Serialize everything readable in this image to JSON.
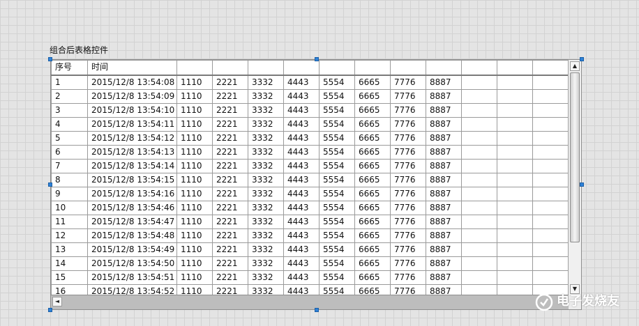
{
  "control_label": "组合后表格控件",
  "table": {
    "headers": [
      "序号",
      "时间",
      "",
      "",
      "",
      "",
      "",
      "",
      "",
      "",
      "",
      "",
      "",
      ""
    ],
    "rows": [
      [
        "1",
        "2015/12/8 13:54:08",
        "1110",
        "2221",
        "3332",
        "4443",
        "5554",
        "6665",
        "7776",
        "8887",
        "",
        "",
        "",
        ""
      ],
      [
        "2",
        "2015/12/8 13:54:09",
        "1110",
        "2221",
        "3332",
        "4443",
        "5554",
        "6665",
        "7776",
        "8887",
        "",
        "",
        "",
        ""
      ],
      [
        "3",
        "2015/12/8 13:54:10",
        "1110",
        "2221",
        "3332",
        "4443",
        "5554",
        "6665",
        "7776",
        "8887",
        "",
        "",
        "",
        ""
      ],
      [
        "4",
        "2015/12/8 13:54:11",
        "1110",
        "2221",
        "3332",
        "4443",
        "5554",
        "6665",
        "7776",
        "8887",
        "",
        "",
        "",
        ""
      ],
      [
        "5",
        "2015/12/8 13:54:12",
        "1110",
        "2221",
        "3332",
        "4443",
        "5554",
        "6665",
        "7776",
        "8887",
        "",
        "",
        "",
        ""
      ],
      [
        "6",
        "2015/12/8 13:54:13",
        "1110",
        "2221",
        "3332",
        "4443",
        "5554",
        "6665",
        "7776",
        "8887",
        "",
        "",
        "",
        ""
      ],
      [
        "7",
        "2015/12/8 13:54:14",
        "1110",
        "2221",
        "3332",
        "4443",
        "5554",
        "6665",
        "7776",
        "8887",
        "",
        "",
        "",
        ""
      ],
      [
        "8",
        "2015/12/8 13:54:15",
        "1110",
        "2221",
        "3332",
        "4443",
        "5554",
        "6665",
        "7776",
        "8887",
        "",
        "",
        "",
        ""
      ],
      [
        "9",
        "2015/12/8 13:54:16",
        "1110",
        "2221",
        "3332",
        "4443",
        "5554",
        "6665",
        "7776",
        "8887",
        "",
        "",
        "",
        ""
      ],
      [
        "10",
        "2015/12/8 13:54:46",
        "1110",
        "2221",
        "3332",
        "4443",
        "5554",
        "6665",
        "7776",
        "8887",
        "",
        "",
        "",
        ""
      ],
      [
        "11",
        "2015/12/8 13:54:47",
        "1110",
        "2221",
        "3332",
        "4443",
        "5554",
        "6665",
        "7776",
        "8887",
        "",
        "",
        "",
        ""
      ],
      [
        "12",
        "2015/12/8 13:54:48",
        "1110",
        "2221",
        "3332",
        "4443",
        "5554",
        "6665",
        "7776",
        "8887",
        "",
        "",
        "",
        ""
      ],
      [
        "13",
        "2015/12/8 13:54:49",
        "1110",
        "2221",
        "3332",
        "4443",
        "5554",
        "6665",
        "7776",
        "8887",
        "",
        "",
        "",
        ""
      ],
      [
        "14",
        "2015/12/8 13:54:50",
        "1110",
        "2221",
        "3332",
        "4443",
        "5554",
        "6665",
        "7776",
        "8887",
        "",
        "",
        "",
        ""
      ],
      [
        "15",
        "2015/12/8 13:54:51",
        "1110",
        "2221",
        "3332",
        "4443",
        "5554",
        "6665",
        "7776",
        "8887",
        "",
        "",
        "",
        ""
      ],
      [
        "16",
        "2015/12/8 13:54:52",
        "1110",
        "2221",
        "3332",
        "4443",
        "5554",
        "6665",
        "7776",
        "8887",
        "",
        "",
        "",
        ""
      ]
    ]
  },
  "icons": {
    "scroll_up": "▲",
    "scroll_down": "▼",
    "scroll_left": "◄"
  },
  "watermark": "电子发烧友",
  "colors": {
    "handle": "#2f82d8",
    "scrollbar_track": "#bdbdbd"
  }
}
